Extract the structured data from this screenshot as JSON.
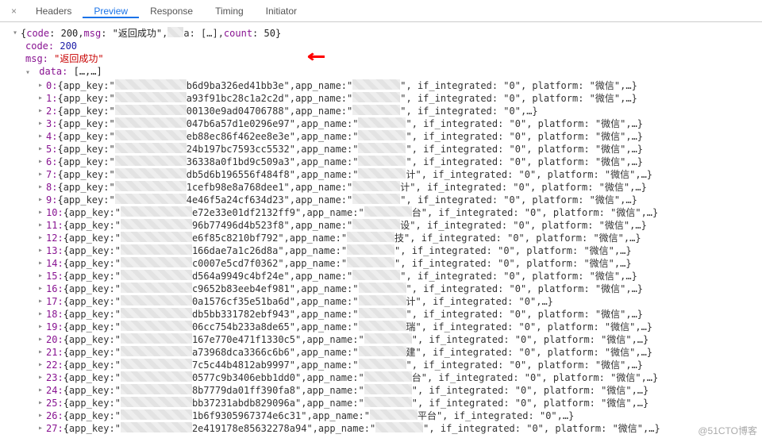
{
  "tabs": {
    "close": "×",
    "items": [
      "Headers",
      "Preview",
      "Response",
      "Timing",
      "Initiator"
    ],
    "active_index": 1
  },
  "arrow_glyph": "←",
  "watermark": "@51CTO博客",
  "summary": {
    "open": "▾ {",
    "code_k": "code",
    "code_v": "200",
    "msg_k": "msg",
    "msg_v": "\"返回成功\"",
    "mid": "a: […],",
    "count_k": "count",
    "count_v": "50",
    "close": "}"
  },
  "detail": {
    "code_k": "code:",
    "code_v": "200",
    "msg_k": "msg:",
    "msg_v": "\"返回成功\"",
    "data_k": "data:",
    "data_v": "[…,…]"
  },
  "labels": {
    "app_key": "app_key:",
    "app_name": "app_name:",
    "if_integrated": "if_integrated:",
    "platform": "platform:",
    "zero": "\"0\"",
    "wechat": "\"微信\"",
    "tail": ",…}",
    "brace_open": "{",
    "comma": ", "
  },
  "rows": [
    {
      "i": "0",
      "key": "b6d9ba326ed41bb3e",
      "name": "\"",
      "int": true,
      "plat": true
    },
    {
      "i": "1",
      "key": "a93f91bc28c1a2c2d",
      "name": "\"",
      "int": true,
      "plat": true
    },
    {
      "i": "2",
      "key": "00130e9ad04706788",
      "name": "\"",
      "int": true,
      "plat": false,
      "int_only": true
    },
    {
      "i": "3",
      "key": "047b6a57d1e0296e97",
      "name": "\"",
      "int": true,
      "plat": true
    },
    {
      "i": "4",
      "key": "eb88ec86f462ee8e3e",
      "name": "\", if_integrated: \"0\", platform: \"微信\",…}",
      "raw": true
    },
    {
      "i": "5",
      "key": "24b197bc7593cc5532",
      "name": "\"",
      "int": true,
      "plat": true
    },
    {
      "i": "6",
      "key": "36338a0f1bd9c509a3",
      "name": "\"",
      "int": true,
      "plat": true
    },
    {
      "i": "7",
      "key": "db5d6b196556f484f8",
      "name": "计\"",
      "int": true,
      "plat": true
    },
    {
      "i": "8",
      "key": "1cefb98e8a768dee1",
      "name": "计\"",
      "int": true,
      "plat": true
    },
    {
      "i": "9",
      "key": "4e46f5a24cf634d23",
      "name": "\"",
      "int": true,
      "plat": true
    },
    {
      "i": "10",
      "key": "e72e33e01df2132ff9",
      "name": "台\"",
      "int": true,
      "plat": true
    },
    {
      "i": "11",
      "key": "96b77496d4b523f8",
      "name": "设\"",
      "int": true,
      "plat": true
    },
    {
      "i": "12",
      "key": "e6f85c8210bf792",
      "name": "技\"",
      "int": true,
      "plat": true
    },
    {
      "i": "13",
      "key": "166dae7a1c26d8a",
      "name": "\"",
      "int": true,
      "plat": true
    },
    {
      "i": "14",
      "key": "c0007e5cd7f0362",
      "name": "\"",
      "int": true,
      "plat": true
    },
    {
      "i": "15",
      "key": "d564a9949c4bf24e",
      "name": "\"",
      "int": true,
      "plat": true
    },
    {
      "i": "16",
      "key": "c9652b83eeb4ef981",
      "name": "\"",
      "int": true,
      "plat": true
    },
    {
      "i": "17",
      "key": "0a1576cf35e51ba6d",
      "name": "计\"",
      "int": true,
      "plat": false,
      "int_only": true
    },
    {
      "i": "18",
      "key": "db5bb331782ebf943",
      "name": "\"",
      "int": true,
      "plat": true
    },
    {
      "i": "19",
      "key": "06cc754b233a8de65",
      "name": "瑞\"",
      "int": true,
      "plat": true
    },
    {
      "i": "20",
      "key": "167e770e471f1330c5",
      "name": "\"",
      "int": true,
      "plat": true
    },
    {
      "i": "21",
      "key": "a73968dca3366c6b6",
      "name": "建\"",
      "int": true,
      "plat": true
    },
    {
      "i": "22",
      "key": "7c5c44b4812ab9997",
      "name": "\"",
      "int": true,
      "plat": true
    },
    {
      "i": "23",
      "key": "0577c9b3406ebb1dd0",
      "name": "台\"",
      "int": true,
      "plat": true
    },
    {
      "i": "24",
      "key": "8b7779da01ff390fa8",
      "name": "\"",
      "int": true,
      "plat": true
    },
    {
      "i": "25",
      "key": "bb37231abdb829096a",
      "name": "\"",
      "int": true,
      "plat": true
    },
    {
      "i": "26",
      "key": "1b6f9305967374e6c31",
      "name": "平台\"",
      "int": true,
      "plat": false,
      "int_only": true
    },
    {
      "i": "27",
      "key": "2e419178e85632278a94",
      "name": "\"",
      "int": true,
      "plat": true
    }
  ]
}
